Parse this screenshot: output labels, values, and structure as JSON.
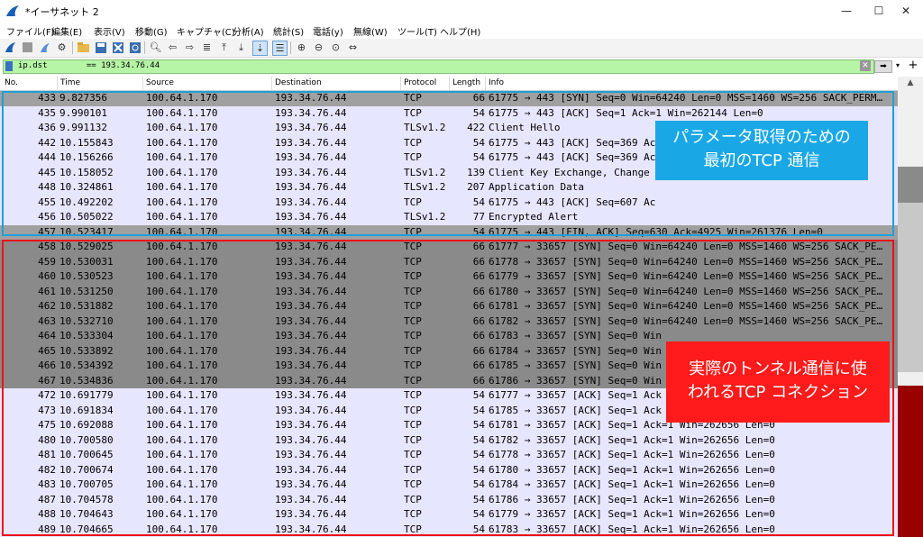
{
  "window": {
    "title": "*イーサネット 2",
    "minimize": "—",
    "maximize": "☐",
    "close": "✕"
  },
  "menu": [
    "ファイル(F)",
    "編集(E)",
    "表示(V)",
    "移動(G)",
    "キャプチャ(C)",
    "分析(A)",
    "統計(S)",
    "電話(y)",
    "無線(W)",
    "ツール(T)",
    "ヘルプ(H)"
  ],
  "filter": {
    "value": "ip.dst        == 193.34.76.44",
    "apply_label": "➡",
    "add_label": "+"
  },
  "columns": {
    "no": "No.",
    "time": "Time",
    "source": "Source",
    "destination": "Destination",
    "protocol": "Protocol",
    "length": "Length",
    "info": "Info"
  },
  "packets": [
    {
      "no": "433",
      "time": "9.827356",
      "src": "100.64.1.170",
      "dst": "193.34.76.44",
      "proto": "TCP",
      "len": "66",
      "info": "61775 → 443 [SYN] Seq=0 Win=64240 Len=0 MSS=1460 WS=256 SACK_PERM…",
      "style": "gray"
    },
    {
      "no": "435",
      "time": "9.990101",
      "src": "100.64.1.170",
      "dst": "193.34.76.44",
      "proto": "TCP",
      "len": "54",
      "info": "61775 → 443 [ACK] Seq=1 Ack=1 Win=262144 Len=0",
      "style": "light"
    },
    {
      "no": "436",
      "time": "9.991132",
      "src": "100.64.1.170",
      "dst": "193.34.76.44",
      "proto": "TLSv1.2",
      "len": "422",
      "info": "Client Hello",
      "style": "light"
    },
    {
      "no": "442",
      "time": "10.155843",
      "src": "100.64.1.170",
      "dst": "193.34.76.44",
      "proto": "TCP",
      "len": "54",
      "info": "61775 → 443 [ACK] Seq=369 Ac",
      "style": "light"
    },
    {
      "no": "444",
      "time": "10.156266",
      "src": "100.64.1.170",
      "dst": "193.34.76.44",
      "proto": "TCP",
      "len": "54",
      "info": "61775 → 443 [ACK] Seq=369 Ac",
      "style": "light"
    },
    {
      "no": "445",
      "time": "10.158052",
      "src": "100.64.1.170",
      "dst": "193.34.76.44",
      "proto": "TLSv1.2",
      "len": "139",
      "info": "Client Key Exchange, Change                         ess…",
      "style": "light"
    },
    {
      "no": "448",
      "time": "10.324861",
      "src": "100.64.1.170",
      "dst": "193.34.76.44",
      "proto": "TLSv1.2",
      "len": "207",
      "info": "Application Data",
      "style": "light"
    },
    {
      "no": "455",
      "time": "10.492202",
      "src": "100.64.1.170",
      "dst": "193.34.76.44",
      "proto": "TCP",
      "len": "54",
      "info": "61775 → 443 [ACK] Seq=607 Ac",
      "style": "light"
    },
    {
      "no": "456",
      "time": "10.505022",
      "src": "100.64.1.170",
      "dst": "193.34.76.44",
      "proto": "TLSv1.2",
      "len": "77",
      "info": "Encrypted Alert",
      "style": "light"
    },
    {
      "no": "457",
      "time": "10.523417",
      "src": "100.64.1.170",
      "dst": "193.34.76.44",
      "proto": "TCP",
      "len": "54",
      "info": "61775 → 443 [FIN, ACK] Seq=630 Ack=4925 Win=261376 Len=0",
      "style": "gray"
    },
    {
      "no": "458",
      "time": "10.529025",
      "src": "100.64.1.170",
      "dst": "193.34.76.44",
      "proto": "TCP",
      "len": "66",
      "info": "61777 → 33657 [SYN] Seq=0 Win=64240 Len=0 MSS=1460 WS=256 SACK_PE…",
      "style": "dark"
    },
    {
      "no": "459",
      "time": "10.530031",
      "src": "100.64.1.170",
      "dst": "193.34.76.44",
      "proto": "TCP",
      "len": "66",
      "info": "61778 → 33657 [SYN] Seq=0 Win=64240 Len=0 MSS=1460 WS=256 SACK_PE…",
      "style": "dark"
    },
    {
      "no": "460",
      "time": "10.530523",
      "src": "100.64.1.170",
      "dst": "193.34.76.44",
      "proto": "TCP",
      "len": "66",
      "info": "61779 → 33657 [SYN] Seq=0 Win=64240 Len=0 MSS=1460 WS=256 SACK_PE…",
      "style": "dark"
    },
    {
      "no": "461",
      "time": "10.531250",
      "src": "100.64.1.170",
      "dst": "193.34.76.44",
      "proto": "TCP",
      "len": "66",
      "info": "61780 → 33657 [SYN] Seq=0 Win=64240 Len=0 MSS=1460 WS=256 SACK_PE…",
      "style": "dark"
    },
    {
      "no": "462",
      "time": "10.531882",
      "src": "100.64.1.170",
      "dst": "193.34.76.44",
      "proto": "TCP",
      "len": "66",
      "info": "61781 → 33657 [SYN] Seq=0 Win=64240 Len=0 MSS=1460 WS=256 SACK_PE…",
      "style": "dark"
    },
    {
      "no": "463",
      "time": "10.532710",
      "src": "100.64.1.170",
      "dst": "193.34.76.44",
      "proto": "TCP",
      "len": "66",
      "info": "61782 → 33657 [SYN] Seq=0 Win=64240 Len=0 MSS=1460 WS=256 SACK_PE…",
      "style": "dark"
    },
    {
      "no": "464",
      "time": "10.533304",
      "src": "100.64.1.170",
      "dst": "193.34.76.44",
      "proto": "TCP",
      "len": "66",
      "info": "61783 → 33657 [SYN] Seq=0 Win",
      "style": "dark"
    },
    {
      "no": "465",
      "time": "10.533892",
      "src": "100.64.1.170",
      "dst": "193.34.76.44",
      "proto": "TCP",
      "len": "66",
      "info": "61784 → 33657 [SYN] Seq=0 Win",
      "style": "dark"
    },
    {
      "no": "466",
      "time": "10.534392",
      "src": "100.64.1.170",
      "dst": "193.34.76.44",
      "proto": "TCP",
      "len": "66",
      "info": "61785 → 33657 [SYN] Seq=0 Win",
      "style": "dark"
    },
    {
      "no": "467",
      "time": "10.534836",
      "src": "100.64.1.170",
      "dst": "193.34.76.44",
      "proto": "TCP",
      "len": "66",
      "info": "61786 → 33657 [SYN] Seq=0 Win",
      "style": "dark"
    },
    {
      "no": "472",
      "time": "10.691779",
      "src": "100.64.1.170",
      "dst": "193.34.76.44",
      "proto": "TCP",
      "len": "54",
      "info": "61777 → 33657 [ACK] Seq=1 Ack",
      "style": "light"
    },
    {
      "no": "473",
      "time": "10.691834",
      "src": "100.64.1.170",
      "dst": "193.34.76.44",
      "proto": "TCP",
      "len": "54",
      "info": "61785 → 33657 [ACK] Seq=1 Ack",
      "style": "light"
    },
    {
      "no": "475",
      "time": "10.692088",
      "src": "100.64.1.170",
      "dst": "193.34.76.44",
      "proto": "TCP",
      "len": "54",
      "info": "61781 → 33657 [ACK] Seq=1 Ack=1 Win=262656 Len=0",
      "style": "light"
    },
    {
      "no": "480",
      "time": "10.700580",
      "src": "100.64.1.170",
      "dst": "193.34.76.44",
      "proto": "TCP",
      "len": "54",
      "info": "61782 → 33657 [ACK] Seq=1 Ack=1 Win=262656 Len=0",
      "style": "light"
    },
    {
      "no": "481",
      "time": "10.700645",
      "src": "100.64.1.170",
      "dst": "193.34.76.44",
      "proto": "TCP",
      "len": "54",
      "info": "61778 → 33657 [ACK] Seq=1 Ack=1 Win=262656 Len=0",
      "style": "light"
    },
    {
      "no": "482",
      "time": "10.700674",
      "src": "100.64.1.170",
      "dst": "193.34.76.44",
      "proto": "TCP",
      "len": "54",
      "info": "61780 → 33657 [ACK] Seq=1 Ack=1 Win=262656 Len=0",
      "style": "light"
    },
    {
      "no": "483",
      "time": "10.700705",
      "src": "100.64.1.170",
      "dst": "193.34.76.44",
      "proto": "TCP",
      "len": "54",
      "info": "61784 → 33657 [ACK] Seq=1 Ack=1 Win=262656 Len=0",
      "style": "light"
    },
    {
      "no": "487",
      "time": "10.704578",
      "src": "100.64.1.170",
      "dst": "193.34.76.44",
      "proto": "TCP",
      "len": "54",
      "info": "61786 → 33657 [ACK] Seq=1 Ack=1 Win=262656 Len=0",
      "style": "light"
    },
    {
      "no": "488",
      "time": "10.704643",
      "src": "100.64.1.170",
      "dst": "193.34.76.44",
      "proto": "TCP",
      "len": "54",
      "info": "61779 → 33657 [ACK] Seq=1 Ack=1 Win=262656 Len=0",
      "style": "light"
    },
    {
      "no": "489",
      "time": "10.704665",
      "src": "100.64.1.170",
      "dst": "193.34.76.44",
      "proto": "TCP",
      "len": "54",
      "info": "61783 → 33657 [ACK] Seq=1 Ack=1 Win=262656 Len=0",
      "style": "light"
    }
  ],
  "annotations": {
    "blue": {
      "line1": "パラメータ取得のための",
      "line2": "最初のTCP 通信"
    },
    "red": {
      "line1": "実際のトンネル通信に使",
      "line2": "われるTCP コネクション"
    }
  },
  "colors": {
    "row_light": "#e7e6ff",
    "row_gray": "#a0a0a0",
    "row_dark": "#8a8a8a",
    "filter_ok": "#b5f5a5",
    "callout_blue": "#1aa7e6",
    "callout_red": "#ff1b1b"
  }
}
